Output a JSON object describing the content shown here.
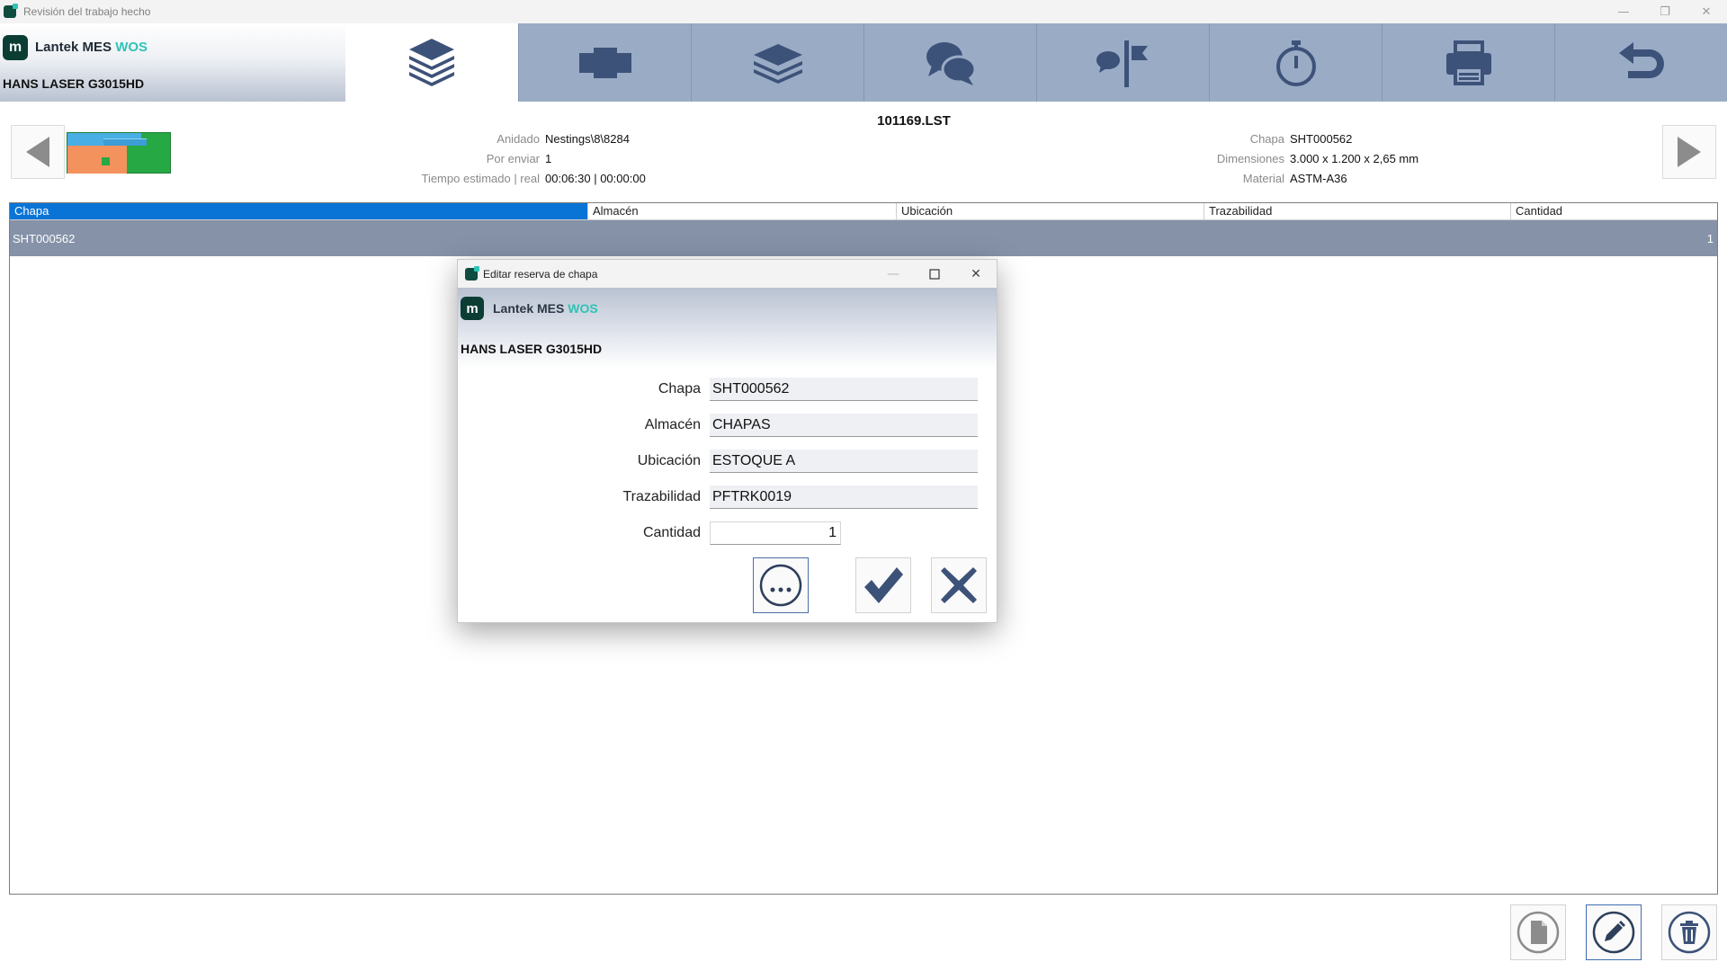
{
  "window": {
    "title": "Revisión del trabajo hecho",
    "controls": {
      "minimize": "—",
      "restore": "❐",
      "close": "✕"
    }
  },
  "brand": {
    "logo_letter": "m",
    "name": "Lantek MES",
    "accent": "WOS",
    "machine": "HANS LASER G3015HD"
  },
  "toolbar": {
    "items": [
      {
        "icon": "stacked-sheets-icon",
        "active": true
      },
      {
        "icon": "part-cross-icon",
        "active": false
      },
      {
        "icon": "layers-icon",
        "active": false
      },
      {
        "icon": "chat-bubbles-icon",
        "active": false
      },
      {
        "icon": "signpost-icon",
        "active": false
      },
      {
        "icon": "stopwatch-icon",
        "active": false
      },
      {
        "icon": "printer-icon",
        "active": false
      },
      {
        "icon": "return-arrow-icon",
        "active": false
      }
    ]
  },
  "job": {
    "filename": "101169.LST",
    "left": [
      {
        "label": "Anidado",
        "value": "Nestings\\8\\8284"
      },
      {
        "label": "Por enviar",
        "value": "1"
      },
      {
        "label": "Tiempo estimado | real",
        "value": "00:06:30 | 00:00:00"
      }
    ],
    "right": [
      {
        "label": "Chapa",
        "value": "SHT000562"
      },
      {
        "label": "Dimensiones",
        "value": "3.000 x 1.200 x 2,65 mm"
      },
      {
        "label": "Material",
        "value": "ASTM-A36"
      }
    ]
  },
  "table": {
    "columns": [
      "Chapa",
      "Almacén",
      "Ubicación",
      "Trazabilidad",
      "Cantidad"
    ],
    "rows": [
      {
        "chapa": "SHT000562",
        "almacen": "",
        "ubicacion": "",
        "trazabilidad": "",
        "cantidad": "1"
      }
    ]
  },
  "dialog": {
    "title": "Editar reserva de chapa",
    "brand_name": "Lantek MES",
    "brand_accent": "WOS",
    "machine": "HANS LASER G3015HD",
    "fields": [
      {
        "label": "Chapa",
        "value": "SHT000562"
      },
      {
        "label": "Almacén",
        "value": "CHAPAS"
      },
      {
        "label": "Ubicación",
        "value": "ESTOQUE A"
      },
      {
        "label": "Trazabilidad",
        "value": "PFTRK0019"
      },
      {
        "label": "Cantidad",
        "value": "1"
      }
    ],
    "buttons": {
      "more": "...",
      "accept": "check-icon",
      "cancel": "close-icon"
    }
  },
  "colors": {
    "toolbar_bg": "#9aabc6",
    "icon_color": "#3d5278",
    "selection": "#0a74d6",
    "row_bg": "#8592a8",
    "accent": "#2ec4b6"
  }
}
